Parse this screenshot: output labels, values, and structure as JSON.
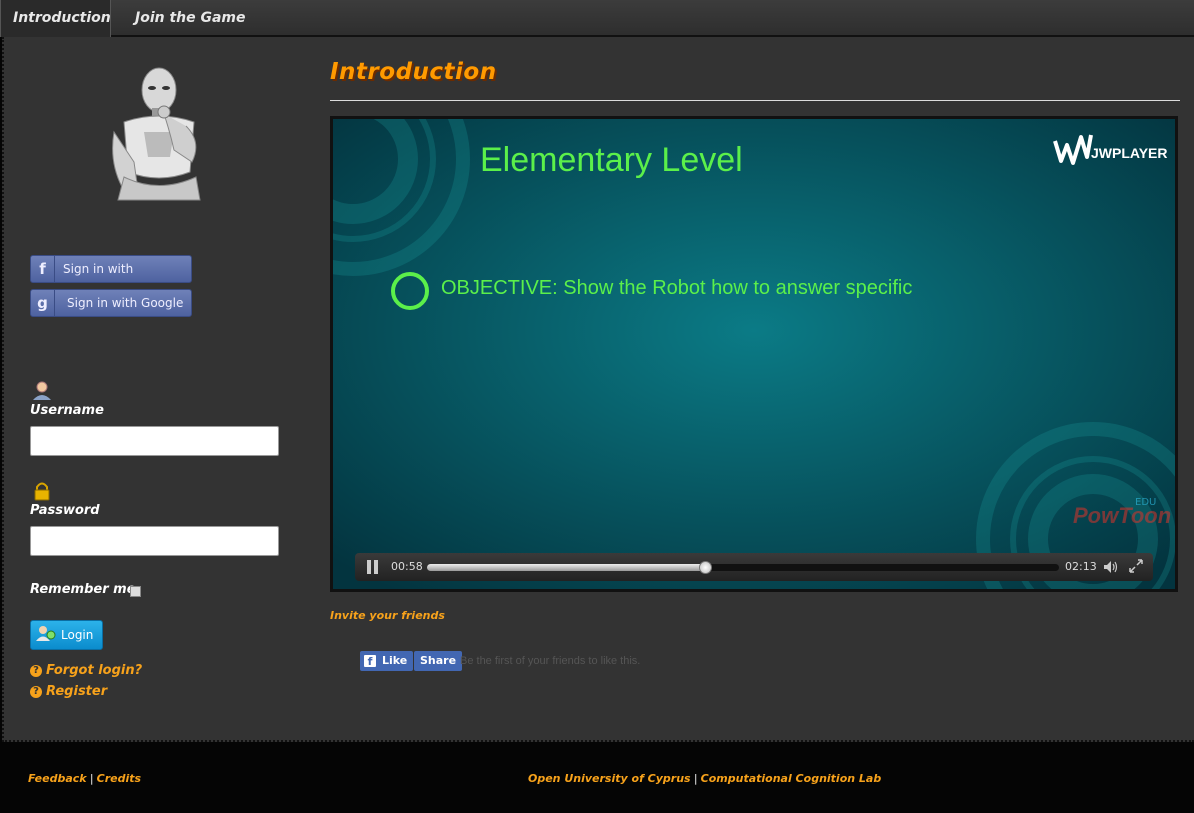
{
  "nav": {
    "tabs": [
      {
        "label": "Introduction",
        "active": true
      },
      {
        "label": "Join the Game",
        "active": false
      }
    ]
  },
  "sidebar": {
    "robot_image": "robot-thinking-image",
    "facebook_label": "Sign in with Facebook",
    "google_label": "Sign in with Google",
    "username_label": "Username",
    "username_value": "",
    "password_label": "Password",
    "password_value": "",
    "remember_label": "Remember me",
    "remember_checked": false,
    "login_label": "Login",
    "forgot_label": "Forgot login?",
    "register_label": "Register"
  },
  "main": {
    "title": "Introduction",
    "video": {
      "slide_title": "Elementary Level",
      "objective": "OBJECTIVE: Show the Robot how to answer specific",
      "player_brand": "JWPLAYER",
      "watermark": "PowToon",
      "watermark_sub": "EDU",
      "elapsed": "00:58",
      "duration": "02:13",
      "progress": 0.44
    },
    "invite_label": "Invite your friends",
    "fb_like_label": "Like",
    "fb_share_label": "Share",
    "fb_social_text": "Be the first of your friends to like this."
  },
  "footer": {
    "feedback": "Feedback",
    "credits": "Credits",
    "university": "Open University of Cyprus",
    "lab": "Computational Cognition Lab",
    "separator": "|"
  },
  "colors": {
    "accent": "#f7a21b",
    "title": "#ff9a00",
    "slide_text": "#5bf04a",
    "facebook": "#4267b2",
    "login": "#0b8ccd"
  }
}
